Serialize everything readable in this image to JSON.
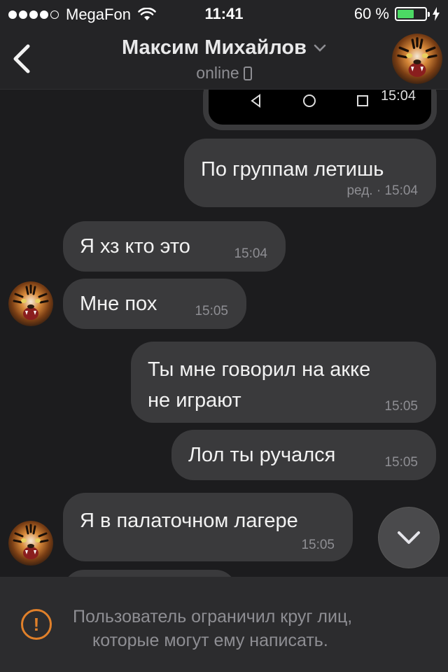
{
  "status_bar": {
    "carrier": "MegaFon",
    "time": "11:41",
    "battery": "60 %",
    "battery_level": 0.6,
    "signal_bars": 4,
    "signal_total": 5
  },
  "header": {
    "back_icon": "chevron-left-icon",
    "title": "Максим Михайлов",
    "title_icon": "chevron-down-icon",
    "status": "online",
    "status_icon": "mobile-phone-icon"
  },
  "messages": [
    {
      "id": "m0",
      "direction": "out",
      "type": "image",
      "time": "15:04"
    },
    {
      "id": "m1",
      "direction": "out",
      "text": "По группам летишь",
      "meta": "ред. · 15:04"
    },
    {
      "id": "m2",
      "direction": "in",
      "text": "Я хз кто это",
      "time": "15:04"
    },
    {
      "id": "m3",
      "direction": "in",
      "text": "Мне пох",
      "time": "15:05"
    },
    {
      "id": "m4",
      "direction": "out",
      "text_line1": "Ты мне говорил на акке",
      "text_line2": "не играют",
      "time": "15:05"
    },
    {
      "id": "m5",
      "direction": "out",
      "text": "Лол ты ручался",
      "time": "15:05"
    },
    {
      "id": "m6",
      "direction": "in",
      "text": "Я в палаточном лагере",
      "time": "15:05"
    }
  ],
  "scroll_button_icon": "chevron-down-icon",
  "footer": {
    "icon": "exclamation-circle-icon",
    "text_line1": "Пользователь ограничил круг лиц,",
    "text_line2": "которые могут ему написать."
  },
  "colors": {
    "background": "#1c1c1e",
    "bubble": "#3a3a3c",
    "warning": "#e0802a",
    "battery_fill": "#4cd964"
  }
}
